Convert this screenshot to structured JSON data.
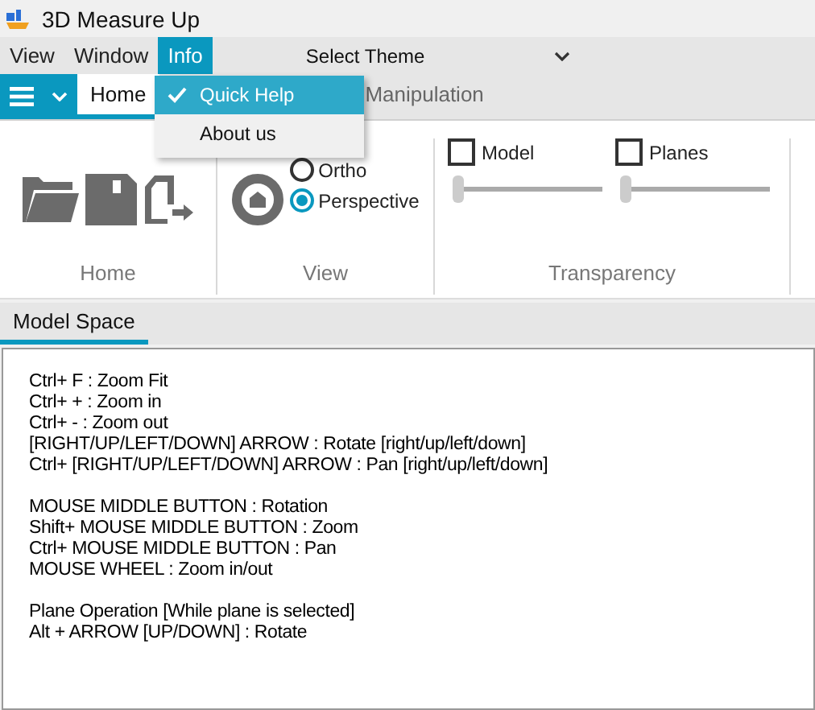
{
  "window": {
    "title": "3D Measure Up"
  },
  "menu_bar": {
    "items": [
      {
        "label": "View",
        "selected": false
      },
      {
        "label": "Window",
        "selected": false
      },
      {
        "label": "Info",
        "selected": true
      }
    ],
    "theme_selector": {
      "label": "Select Theme"
    }
  },
  "dropdown_menu": {
    "items": [
      {
        "label": "Quick Help",
        "checked": true,
        "highlighted": true
      },
      {
        "label": "About us",
        "checked": false,
        "highlighted": false
      }
    ]
  },
  "ribbon_tabs": [
    {
      "label": "Home",
      "selected": true
    },
    {
      "label": "Manipulation",
      "selected": false
    }
  ],
  "ribbon_groups": [
    {
      "kind": "home",
      "label": "Home"
    },
    {
      "kind": "view",
      "label": "View",
      "radios": [
        {
          "label": "Ortho",
          "selected": false
        },
        {
          "label": "Perspective",
          "selected": true
        }
      ]
    },
    {
      "kind": "transparency",
      "label": "Transparency",
      "controls": [
        {
          "label": "Model",
          "checked": false,
          "level": 0
        },
        {
          "label": "Planes",
          "checked": false,
          "level": 0
        }
      ]
    }
  ],
  "document_tabs": [
    {
      "label": "Model Space",
      "selected": true
    }
  ],
  "help_paragraphs": [
    [
      "Ctrl+ F : Zoom Fit",
      "Ctrl+ + : Zoom in",
      "Ctrl+ - : Zoom out",
      "[RIGHT/UP/LEFT/DOWN] ARROW : Rotate [right/up/left/down]",
      "Ctrl+ [RIGHT/UP/LEFT/DOWN] ARROW : Pan [right/up/left/down]"
    ],
    [
      "MOUSE MIDDLE BUTTON : Rotation",
      "Shift+ MOUSE MIDDLE BUTTON : Zoom",
      "Ctrl+ MOUSE MIDDLE BUTTON : Pan",
      "MOUSE WHEEL : Zoom in/out"
    ],
    [
      "Plane Operation [While plane is selected]",
      "Alt + ARROW [UP/DOWN] : Rotate"
    ]
  ]
}
